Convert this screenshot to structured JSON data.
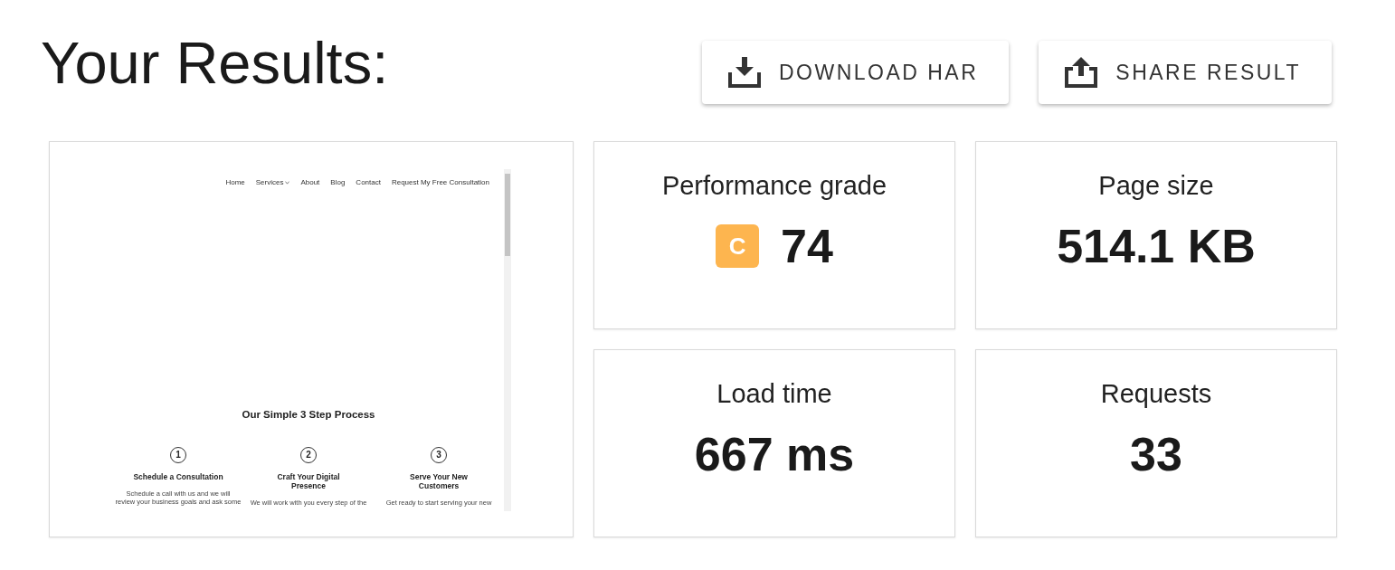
{
  "header": {
    "title": "Your Results:",
    "buttons": [
      {
        "label": "DOWNLOAD HAR",
        "kind": "download"
      },
      {
        "label": "SHARE RESULT",
        "kind": "share"
      }
    ]
  },
  "preview": {
    "nav": [
      {
        "label": "Home",
        "dropdown": false
      },
      {
        "label": "Services",
        "dropdown": true
      },
      {
        "label": "About",
        "dropdown": false
      },
      {
        "label": "Blog",
        "dropdown": false
      },
      {
        "label": "Contact",
        "dropdown": false
      },
      {
        "label": "Request My Free Consultation",
        "dropdown": false
      }
    ],
    "heading": "Our Simple 3 Step Process",
    "steps": [
      {
        "number": "1",
        "title": "Schedule a Consultation",
        "text": "Schedule a call with us and we will\nreview your business goals and ask some"
      },
      {
        "number": "2",
        "title": "Craft Your Digital\nPresence",
        "text": "We will work with you every step of the"
      },
      {
        "number": "3",
        "title": "Serve Your New\nCustomers",
        "text": "Get ready to start serving your new"
      }
    ]
  },
  "metrics": [
    {
      "kind": "grade",
      "label": "Performance grade",
      "value": "74",
      "grade": {
        "letter": "C",
        "color": "#fdb54f"
      }
    },
    {
      "kind": "plain",
      "label": "Page size",
      "value": "514.1 KB"
    },
    {
      "kind": "plain",
      "label": "Load time",
      "value": "667 ms"
    },
    {
      "kind": "plain",
      "label": "Requests",
      "value": "33"
    }
  ]
}
